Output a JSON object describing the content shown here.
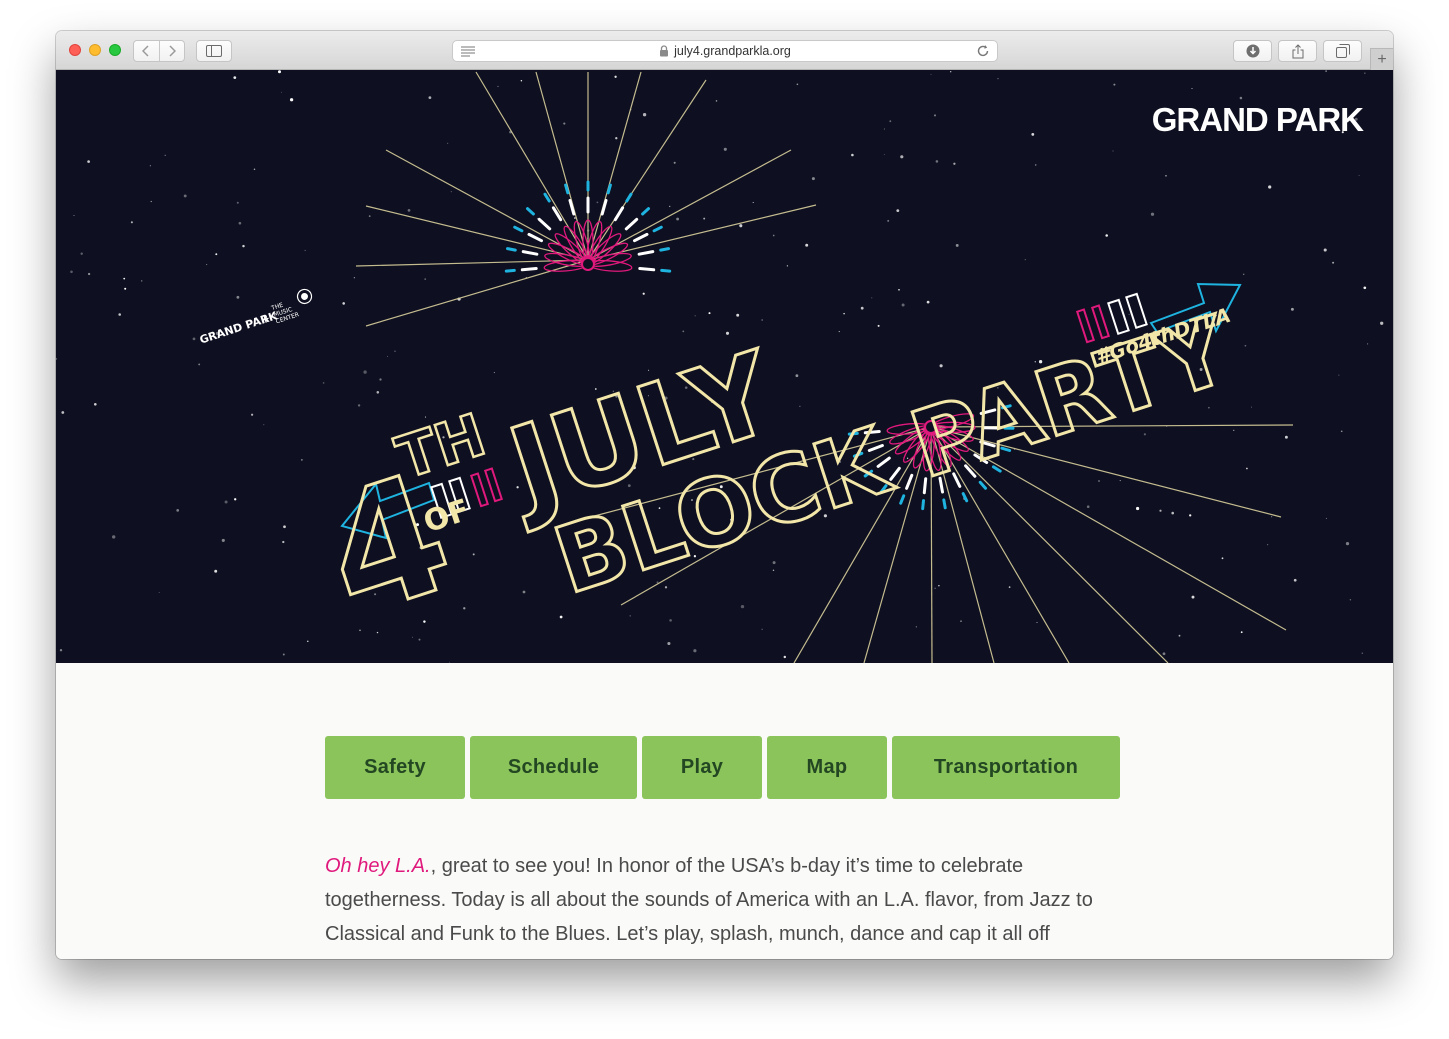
{
  "browser": {
    "url": "july4.grandparkla.org",
    "new_tab_symbol": "+"
  },
  "hero": {
    "brand_logo": "GRAND PARK",
    "partner_logo": "GRAND PARK",
    "partner_plus": "+",
    "partner_name_lines": [
      "THE",
      "MUSIC",
      "CENTER"
    ],
    "title_line1_number": "4",
    "title_line1_suffix": "TH",
    "title_line1_word": "JULY",
    "title_of": "OF",
    "title_line2": "BLOCK PARTY",
    "hashtag": "#Go4thDTLA"
  },
  "nav": {
    "tabs": [
      {
        "label": "Safety"
      },
      {
        "label": "Schedule"
      },
      {
        "label": "Play"
      },
      {
        "label": "Map"
      },
      {
        "label": "Transportation"
      }
    ]
  },
  "intro": {
    "greeting": "Oh hey L.A.",
    "text": ", great to see you! In honor of the USA’s b-day it’s time to celebrate togetherness. Today is all about the sounds of America with an L.A. flavor, from Jazz to Classical and Funk to the Blues. Let’s play, splash, munch, dance and cap it all off"
  },
  "colors": {
    "hero_bg": "#0e0f20",
    "title_stroke": "#f2e6a8",
    "accent_pink": "#e0197d",
    "accent_cyan": "#1fb3e0",
    "tab_bg": "#8bc45a",
    "tab_text": "#234722",
    "greeting_color": "#e0197d"
  }
}
